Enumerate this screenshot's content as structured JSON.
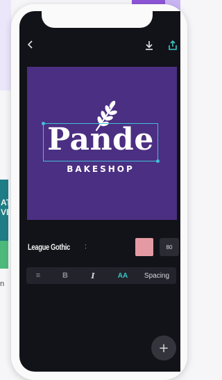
{
  "background": {
    "card_lines": [
      "AT",
      "VE"
    ],
    "caption": "n"
  },
  "editor": {
    "canvas": {
      "background_color": "#4b2f82",
      "logo_title": "Pande",
      "logo_subtitle": "BAKESHOP",
      "selection_color": "#41c0d8"
    },
    "font_row": {
      "font_name": "League Gothic",
      "dropdown_glyph": ":",
      "color_swatch": "#e59aa3",
      "size_value": "80"
    },
    "toolbar": {
      "align_glyph": "≡",
      "bold_glyph": "B",
      "italic_glyph": "I",
      "case_label": "AA",
      "spacing_label": "Spacing"
    },
    "fab_glyph": "+"
  }
}
